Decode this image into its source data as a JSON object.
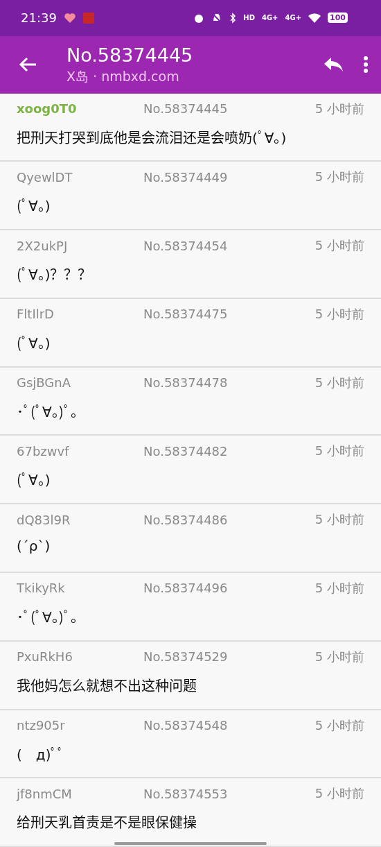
{
  "status_bar": {
    "time": "21:39",
    "hd": "HD",
    "networks": [
      "4G+",
      "4G+"
    ],
    "battery": "100"
  },
  "app_bar": {
    "title": "No.58374445",
    "subtitle": "X岛 · nmbxd.com"
  },
  "posts": [
    {
      "author": "xoog0T0",
      "op": true,
      "number": "No.58374445",
      "time": "5 小时前",
      "content": "把刑天打哭到底他是会流泪还是会喷奶(ﾟ∀。)"
    },
    {
      "author": "QyewlDT",
      "op": false,
      "number": "No.58374449",
      "time": "5 小时前",
      "content": "(ﾟ∀。)"
    },
    {
      "author": "2X2ukPJ",
      "op": false,
      "number": "No.58374454",
      "time": "5 小时前",
      "content": "(ﾟ∀。)？？？"
    },
    {
      "author": "FltIlrD",
      "op": false,
      "number": "No.58374475",
      "time": "5 小时前",
      "content": "(ﾟ∀。)"
    },
    {
      "author": "GsjBGnA",
      "op": false,
      "number": "No.58374478",
      "time": "5 小时前",
      "content": "･ﾟ(ﾟ∀。)ﾟ。"
    },
    {
      "author": "67bzwvf",
      "op": false,
      "number": "No.58374482",
      "time": "5 小时前",
      "content": "(ﾟ∀。)"
    },
    {
      "author": "dQ83l9R",
      "op": false,
      "number": "No.58374486",
      "time": "5 小时前",
      "content": "(´ρ`)"
    },
    {
      "author": "TkikyRk",
      "op": false,
      "number": "No.58374496",
      "time": "5 小时前",
      "content": "･ﾟ(ﾟ∀。)ﾟ。"
    },
    {
      "author": "PxuRkH6",
      "op": false,
      "number": "No.58374529",
      "time": "5 小时前",
      "content": "我他妈怎么就想不出这种问题"
    },
    {
      "author": "ntz905r",
      "op": false,
      "number": "No.58374548",
      "time": "5 小时前",
      "content": "(　д)ﾟﾟ"
    },
    {
      "author": "jf8nmCM",
      "op": false,
      "number": "No.58374553",
      "time": "5 小时前",
      "content": "给刑天乳首责是不是眼保健操"
    }
  ]
}
